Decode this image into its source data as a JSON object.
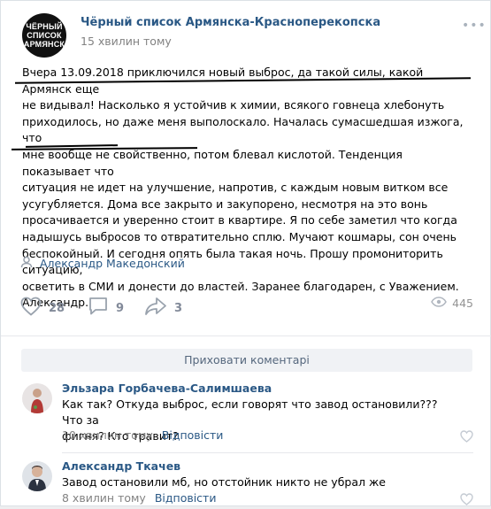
{
  "post": {
    "group_name": "Чёрный список Армянска-Красноперекопска",
    "logo_lines": [
      "ЧЁРНЫЙ",
      "СПИСОК",
      "АРМЯНСК"
    ],
    "time": "15 хвилин тому",
    "text_lines": [
      "Вчера 13.09.2018 приключился новый выброс, да такой силы, какой Армянск еще",
      "не видывал! Насколько я устойчив к химии, всякого говнеца хлебонуть",
      "приходилось, но даже меня выполоскало. Началась сумасшедшая изжога, что",
      "мне вообще не свойственно, потом блевал кислотой. Тенденция показывает что",
      "ситуация не идет на улучшение, напротив, с каждым новым витком все",
      "усугубляется. Дома все закрыто и закупорено, несмотря на это вонь",
      "просачивается и уверенно стоит в квартире. Я по себе заметил что когда",
      "надышусь выбросов то отвратительно сплю. Мучают кошмары, сон очень",
      "беспокойный. И сегодня опять была такая ночь. Прошу промониторить ситуацию,",
      "осветить в СМИ и донести до властей. Заранее благодарен, с Уважением.",
      "Александр."
    ],
    "author": "Александр Македонский",
    "likes": "28",
    "comments": "9",
    "shares": "3",
    "views": "445"
  },
  "hide_comments_label": "Приховати коментарі",
  "comments": [
    {
      "name": "Эльзара Горбачева-Салимшаева",
      "text_lines": [
        "Как так? Откуда выброс, если говорят что завод остановили??? Что за",
        "фигня? Кто травит?"
      ],
      "time": "10 хвилин тому",
      "reply": "Відповісти"
    },
    {
      "name": "Александр Ткачев",
      "text_lines": [
        "Завод остановили мб, но отстойник никто не убрал же"
      ],
      "time": "8 хвилин тому",
      "reply": "Відповісти"
    }
  ],
  "colors": {
    "link": "#2a5885",
    "muted": "#828282",
    "icon": "#828a99",
    "button_bg": "#f0f2f5"
  }
}
